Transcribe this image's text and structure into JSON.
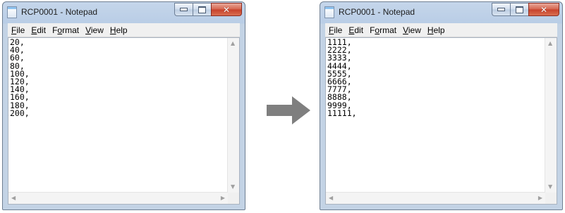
{
  "left_window": {
    "title": "RCP0001 - Notepad",
    "menu": [
      {
        "pre": "",
        "u": "F",
        "post": "ile"
      },
      {
        "pre": "",
        "u": "E",
        "post": "dit"
      },
      {
        "pre": "F",
        "u": "o",
        "post": "rmat"
      },
      {
        "pre": "",
        "u": "V",
        "post": "iew"
      },
      {
        "pre": "",
        "u": "H",
        "post": "elp"
      }
    ],
    "content": "20,\n40,\n60,\n80,\n100,\n120,\n140,\n160,\n180,\n200,"
  },
  "right_window": {
    "title": "RCP0001 - Notepad",
    "menu": [
      {
        "pre": "",
        "u": "F",
        "post": "ile"
      },
      {
        "pre": "",
        "u": "E",
        "post": "dit"
      },
      {
        "pre": "F",
        "u": "o",
        "post": "rmat"
      },
      {
        "pre": "",
        "u": "V",
        "post": "iew"
      },
      {
        "pre": "",
        "u": "H",
        "post": "elp"
      }
    ],
    "content": "1111,\n2222,\n3333,\n4444,\n5555,\n6666,\n7777,\n8888,\n9999,\n11111,"
  },
  "icons": {
    "window_icon": "notepad-icon",
    "transition": "right-arrow-icon"
  },
  "colors": {
    "arrow": "#7f7f7f",
    "close_button": "#c7402a"
  }
}
